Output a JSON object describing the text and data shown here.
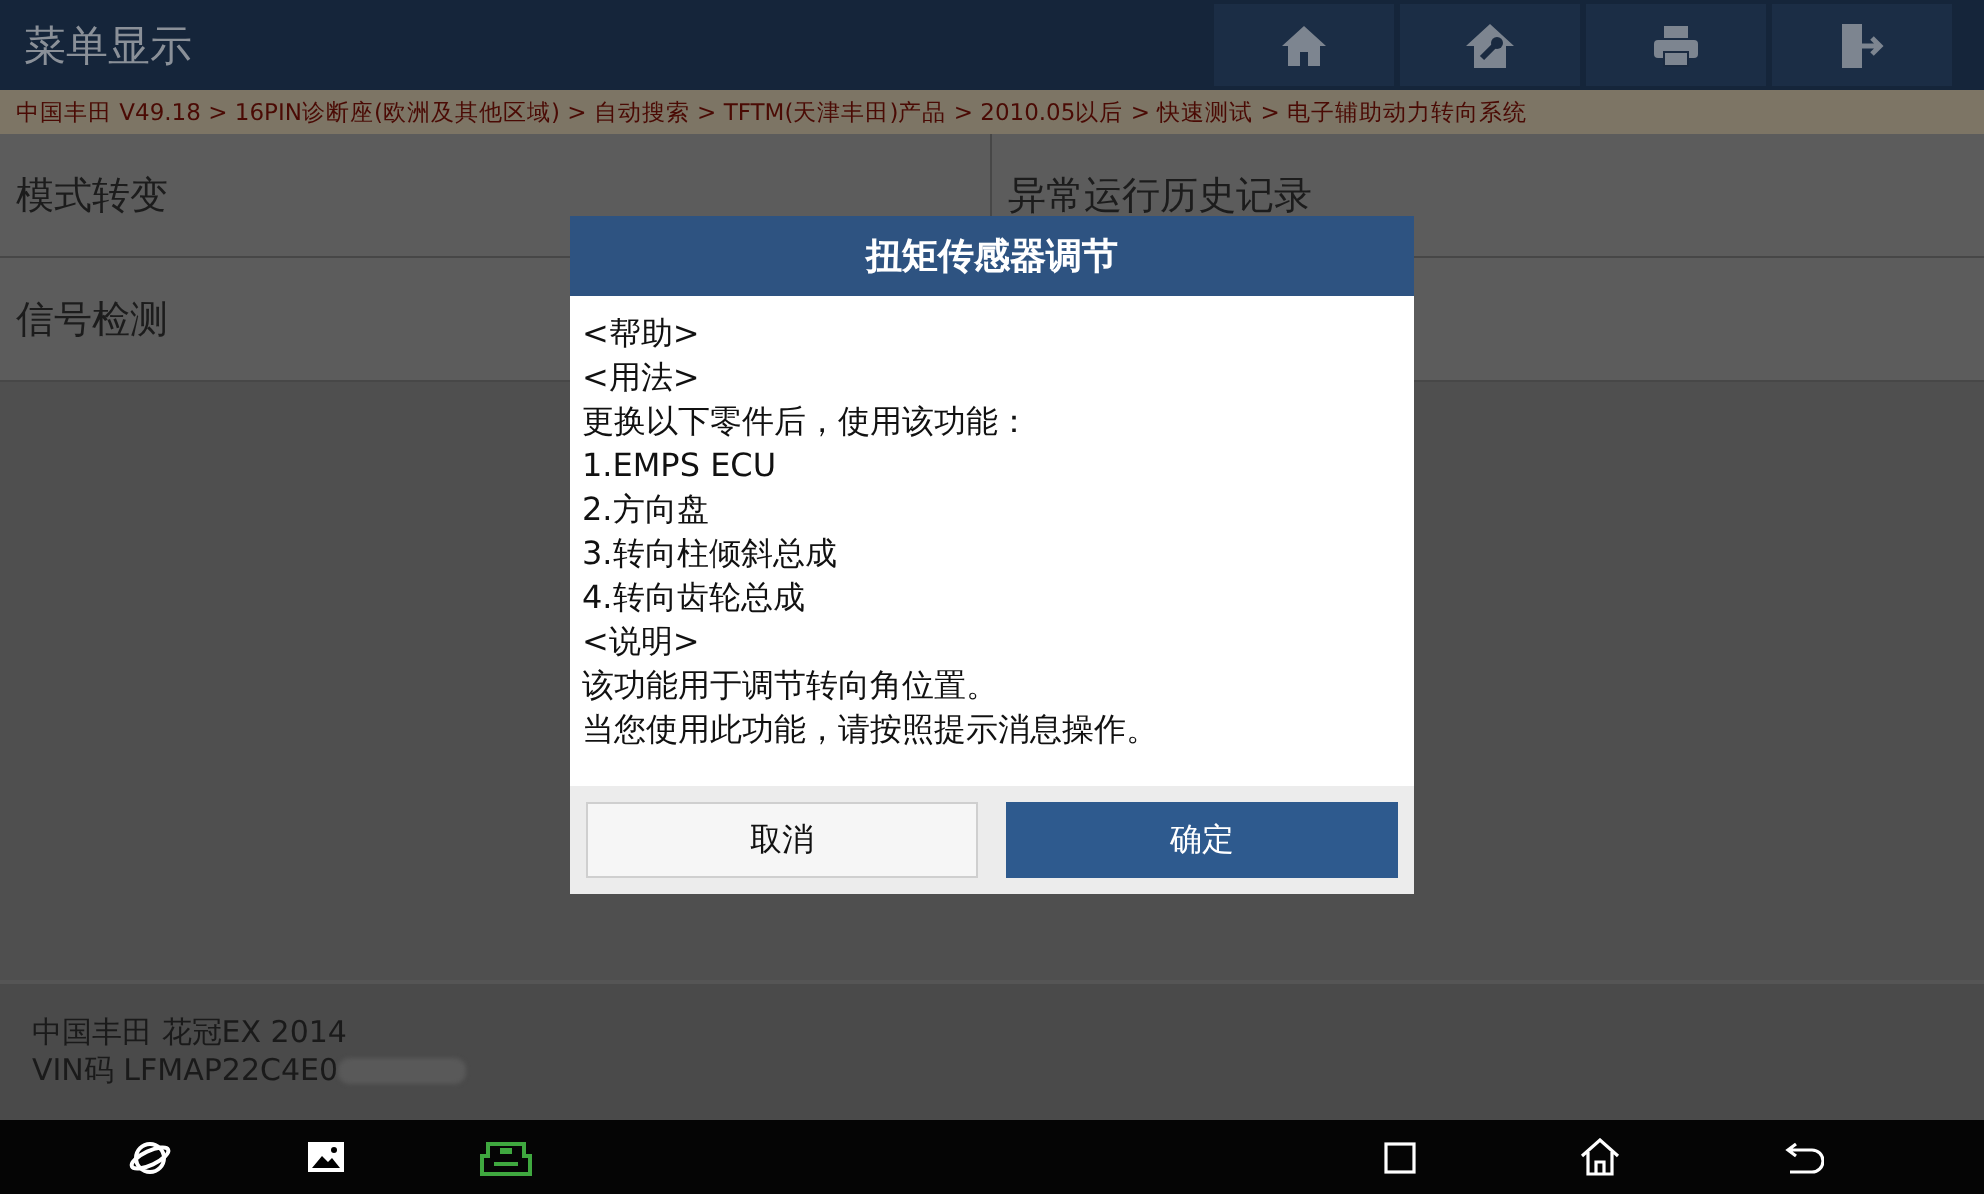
{
  "header": {
    "title": "菜单显示"
  },
  "breadcrumb": "中国丰田 V49.18 > 16PIN诊断座(欧洲及其他区域) > 自动搜索 > TFTM(天津丰田)产品 > 2010.05以后 > 快速测试 > 电子辅助动力转向系统",
  "menu": [
    "模式转变",
    "异常运行历史记录",
    "信号检测"
  ],
  "dialog": {
    "title": "扭矩传感器调节",
    "lines": [
      "<帮助>",
      "<用法>",
      "更换以下零件后，使用该功能：",
      "1.EMPS ECU",
      "2.方向盘",
      "3.转向柱倾斜总成",
      "4.转向齿轮总成",
      "<说明>",
      "该功能用于调节转向角位置。",
      "当您使用此功能，请按照提示消息操作。"
    ],
    "buttons": [
      {
        "label": "取消",
        "kind": "secondary"
      },
      {
        "label": "确定",
        "kind": "primary"
      }
    ]
  },
  "vehicle": {
    "model": "中国丰田 花冠EX 2014",
    "vin": "VIN码 LFMAP22C4E0"
  }
}
